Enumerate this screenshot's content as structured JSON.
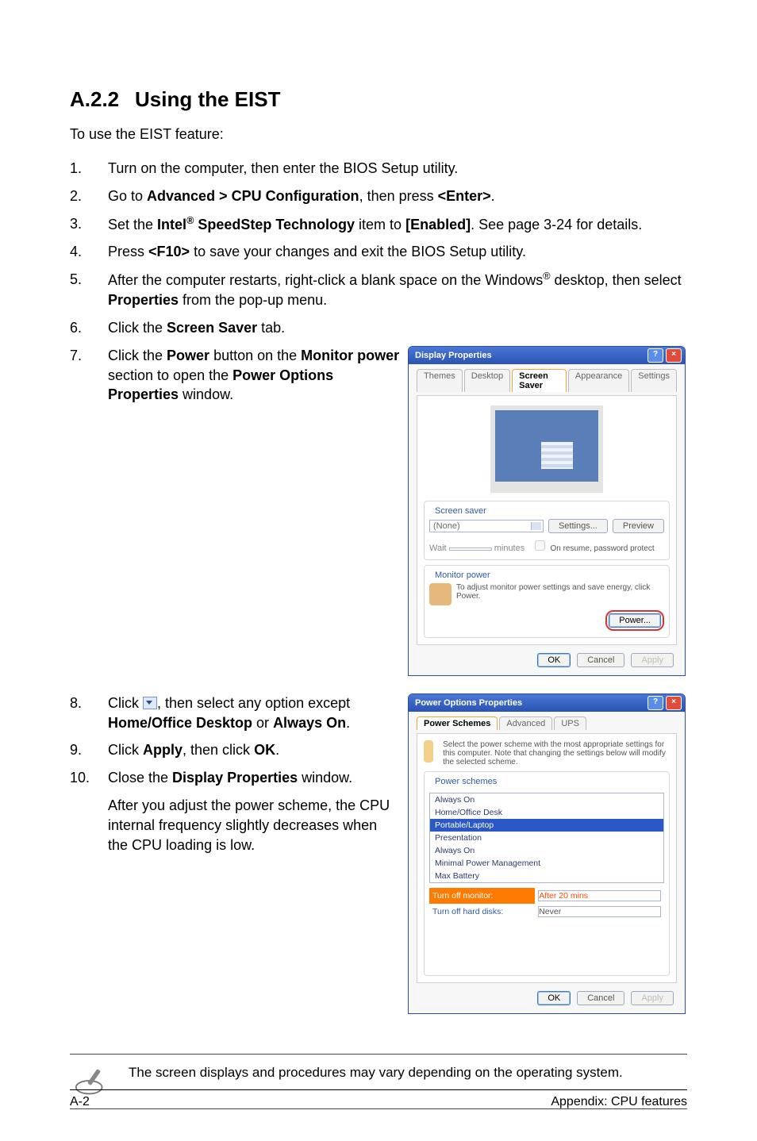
{
  "section": {
    "number": "A.2.2",
    "title": "Using the EIST"
  },
  "intro": "To use the EIST feature:",
  "steps": {
    "s1": {
      "n": "1.",
      "t": "Turn on the computer, then enter the BIOS Setup utility."
    },
    "s2": {
      "n": "2.",
      "pre": "Go to ",
      "path": "Advanced > CPU Configuration",
      "mid": ", then press ",
      "key": "<Enter>",
      "post": "."
    },
    "s3": {
      "n": "3.",
      "pre": "Set the ",
      "brand": "Intel",
      "reg": "®",
      "item": " SpeedStep Technology",
      "mid": " item to ",
      "val": "[Enabled]",
      "post": ". See page 3-24 for details."
    },
    "s4": {
      "n": "4.",
      "pre": "Press ",
      "key": "<F10>",
      "post": " to save your changes and exit the BIOS Setup utility."
    },
    "s5": {
      "n": "5.",
      "pre": "After the computer restarts, right-click a blank space on the Windows",
      "reg": "®",
      "mid": " desktop, then select ",
      "b": "Properties",
      "post": " from the pop-up menu."
    },
    "s6": {
      "n": "6.",
      "pre": "Click the ",
      "b": "Screen Saver",
      "post": " tab."
    },
    "s7": {
      "n": "7.",
      "pre": "Click the ",
      "b1": "Power",
      "mid1": " button on the ",
      "b2": "Monitor power",
      "mid2": " section to open the ",
      "b3": "Power Options Properties",
      "post": " window."
    },
    "s8": {
      "n": "8.",
      "pre": "Click ",
      "mid": ", then select any option except ",
      "b1": "Home/Office Desktop",
      "or": " or ",
      "b2": "Always On",
      "post": "."
    },
    "s9": {
      "n": "9.",
      "pre": "Click ",
      "b1": "Apply",
      "mid": ", then click ",
      "b2": "OK",
      "post": "."
    },
    "s10": {
      "n": "10.",
      "pre": "Close the ",
      "b": "Display Properties",
      "post": " window."
    },
    "after": "After you adjust the power scheme, the CPU internal frequency slightly decreases when the CPU loading is low."
  },
  "note": "The screen displays and procedures may vary depending on the operating system.",
  "footer": {
    "left": "A-2",
    "right": "Appendix: CPU features"
  },
  "dlg1": {
    "title": "Display Properties",
    "help": "?",
    "close": "×",
    "tabs": {
      "t1": "Themes",
      "t2": "Desktop",
      "t3": "Screen Saver",
      "t4": "Appearance",
      "t5": "Settings"
    },
    "group_ss": "Screen saver",
    "ss_value": "(None)",
    "btn_settings": "Settings...",
    "btn_preview": "Preview",
    "wait_label": "Wait",
    "wait_min": "minutes",
    "resume_label": "On resume, password protect",
    "group_mp": "Monitor power",
    "mp_text": "To adjust monitor power settings and save energy, click Power.",
    "btn_power": "Power...",
    "btn_ok": "OK",
    "btn_cancel": "Cancel",
    "btn_apply": "Apply"
  },
  "dlg2": {
    "title": "Power Options Properties",
    "help": "?",
    "close": "×",
    "tabs": {
      "t1": "Power Schemes",
      "t2": "Advanced",
      "t3": "UPS"
    },
    "desc": "Select the power scheme with the most appropriate settings for this computer. Note that changing the settings below will modify the selected scheme.",
    "group_ps": "Power schemes",
    "options": {
      "o1": "Always On",
      "o2": "Home/Office Desk",
      "o3": "Portable/Laptop",
      "o4": "Presentation",
      "o5": "Always On",
      "o6": "Minimal Power Management",
      "o7": "Max Battery"
    },
    "row_monitor": "Turn off monitor:",
    "val_monitor": "After 20 mins",
    "row_hd": "Turn off hard disks:",
    "val_hd": "Never",
    "btn_ok": "OK",
    "btn_cancel": "Cancel",
    "btn_apply": "Apply"
  }
}
